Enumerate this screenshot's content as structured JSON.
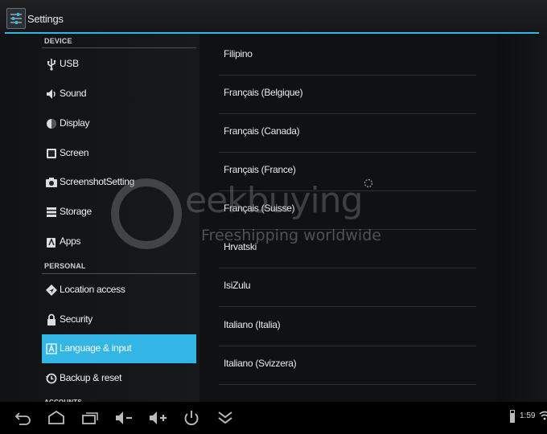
{
  "action_bar": {
    "title": "Settings"
  },
  "sidebar": {
    "sections": {
      "device": "DEVICE",
      "personal": "PERSONAL",
      "accounts": "ACCOUNTS"
    },
    "items": [
      {
        "label": "USB",
        "icon": "usb-icon"
      },
      {
        "label": "Sound",
        "icon": "speaker-icon"
      },
      {
        "label": "Display",
        "icon": "brightness-icon"
      },
      {
        "label": "Screen",
        "icon": "screen-icon"
      },
      {
        "label": "ScreenshotSetting",
        "icon": "camera-icon"
      },
      {
        "label": "Storage",
        "icon": "storage-icon"
      },
      {
        "label": "Apps",
        "icon": "apps-icon"
      },
      {
        "label": "Location access",
        "icon": "location-icon"
      },
      {
        "label": "Security",
        "icon": "lock-icon"
      },
      {
        "label": "Language & input",
        "icon": "keyboard-a-icon",
        "selected": true
      },
      {
        "label": "Backup & reset",
        "icon": "backup-icon"
      }
    ]
  },
  "languages": [
    "Filipino",
    "Français (Belgique)",
    "Français (Canada)",
    "Français (France)",
    "Français (Suisse)",
    "Hrvatski",
    "IsiZulu",
    "Italiano (Italia)",
    "Italiano (Svizzera)"
  ],
  "watermark": {
    "brand": "eekbuying",
    "tagline": "Freeshipping worldwide"
  },
  "navbar": {
    "buttons": [
      "back-icon",
      "home-icon",
      "recents-icon",
      "volume-down-icon",
      "volume-up-icon",
      "power-icon",
      "collapse-icon"
    ]
  },
  "status": {
    "time": "1:59"
  },
  "colors": {
    "accent": "#33b5e5",
    "background": "#0f1113"
  }
}
